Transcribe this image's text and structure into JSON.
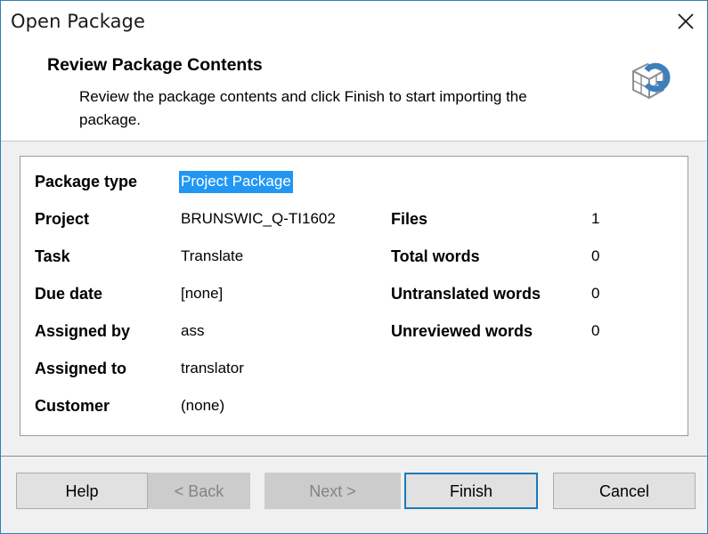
{
  "window": {
    "title": "Open Package",
    "close_icon": "close-icon"
  },
  "header": {
    "title": "Review Package Contents",
    "description": "Review the package contents and click Finish to start importing the package.",
    "icon": "package-import-icon"
  },
  "panel": {
    "left_fields": [
      {
        "label": "Package type",
        "value": "Project Package",
        "highlighted": true
      },
      {
        "label": "Project",
        "value": "BRUNSWIC_Q-TI1602",
        "highlighted": false
      },
      {
        "label": "Task",
        "value": "Translate",
        "highlighted": false
      },
      {
        "label": "Due date",
        "value": "[none]",
        "highlighted": false
      },
      {
        "label": "Assigned by",
        "value": "ass",
        "highlighted": false
      },
      {
        "label": "Assigned to",
        "value": "translator",
        "highlighted": false
      },
      {
        "label": "Customer",
        "value": "(none)",
        "highlighted": false
      }
    ],
    "right_fields": [
      {
        "label": "Files",
        "value": "1"
      },
      {
        "label": "Total words",
        "value": "0"
      },
      {
        "label": "Untranslated words",
        "value": "0"
      },
      {
        "label": "Unreviewed words",
        "value": "0"
      }
    ]
  },
  "footer": {
    "help": "Help",
    "back": "< Back",
    "next": "Next >",
    "finish": "Finish",
    "cancel": "Cancel"
  },
  "colors": {
    "window_border": "#2f7fb5",
    "selection": "#2196f3",
    "focus_border": "#1b7ab8",
    "panel_bg": "#ffffff",
    "body_bg": "#f0f0f0",
    "button_bg": "#e1e1e1",
    "button_disabled_bg": "#cccccc",
    "icon_blue": "#3c7fbd",
    "icon_grey": "#8b8f96"
  }
}
